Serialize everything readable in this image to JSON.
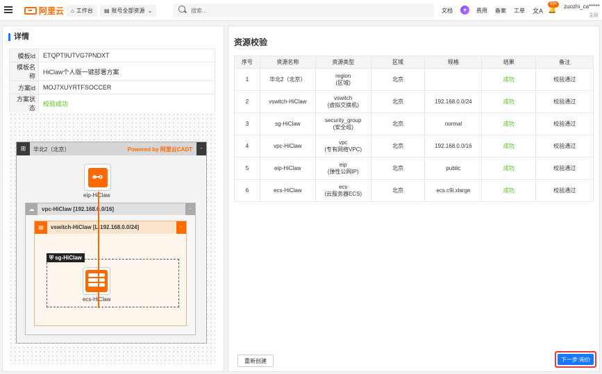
{
  "topbar": {
    "logo_text": "阿里云",
    "workbench": "工作台",
    "account_resources": "账号全部资源",
    "search_placeholder": "搜索...",
    "links": [
      "文档",
      "费用",
      "备案",
      "工单"
    ],
    "badge": "99+",
    "user_name": "zuozhi_ca*****",
    "user_sub": "主账"
  },
  "detail": {
    "title": "详情",
    "rows": [
      {
        "key": "模板Id",
        "value": "ETQPT9UTVG7PNDXT"
      },
      {
        "key": "模板名称",
        "value": "HiClaw个人版一键部署方案"
      },
      {
        "key": "方案id",
        "value": "MOJ7XUYRTFSOCCER"
      },
      {
        "key": "方案状态",
        "value": "校验成功"
      }
    ]
  },
  "diagram": {
    "region": "华北2（北京）",
    "powered": "Powered by 阿里云CADT",
    "eip": "eip-HiClaw",
    "vpc": "vpc-HiClaw [192.168.0.0/16]",
    "vswitch": "vswitch-HiClaw [L-192.168.0.0/24]",
    "sg": "sg-HiClaw",
    "ecs": "ecs-HiClaw",
    "collapse": "-"
  },
  "validation": {
    "title": "资源校验",
    "headers": [
      "序号",
      "资源名称",
      "资源类型",
      "区域",
      "规格",
      "结果",
      "备注"
    ],
    "rows": [
      {
        "no": "1",
        "name": "华北2（北京）",
        "type": "region",
        "type_cn": "(区域)",
        "region": "北京",
        "spec": "",
        "result": "成功",
        "note": "校验通过"
      },
      {
        "no": "2",
        "name": "vswitch-HiClaw",
        "type": "vswitch",
        "type_cn": "(虚拟交换机)",
        "region": "北京",
        "spec": "192.168.0.0/24",
        "result": "成功",
        "note": "校验通过"
      },
      {
        "no": "3",
        "name": "sg-HiClaw",
        "type": "security_group",
        "type_cn": "(安全组)",
        "region": "北京",
        "spec": "normal",
        "result": "成功",
        "note": "校验通过"
      },
      {
        "no": "4",
        "name": "vpc-HiClaw",
        "type": "vpc",
        "type_cn": "(专有网络VPC)",
        "region": "北京",
        "spec": "192.168.0.0/16",
        "result": "成功",
        "note": "校验通过"
      },
      {
        "no": "5",
        "name": "eip-HiClaw",
        "type": "eip",
        "type_cn": "(弹性公网IP)",
        "region": "北京",
        "spec": "public",
        "result": "成功",
        "note": "校验通过"
      },
      {
        "no": "6",
        "name": "ecs-HiClaw",
        "type": "ecs",
        "type_cn": "(云服务器ECS)",
        "region": "北京",
        "spec": "ecs.c9i.xlarge",
        "result": "成功",
        "note": "校验通过"
      }
    ],
    "recreate_label": "重新创建",
    "next_label": "下一步:询价"
  }
}
